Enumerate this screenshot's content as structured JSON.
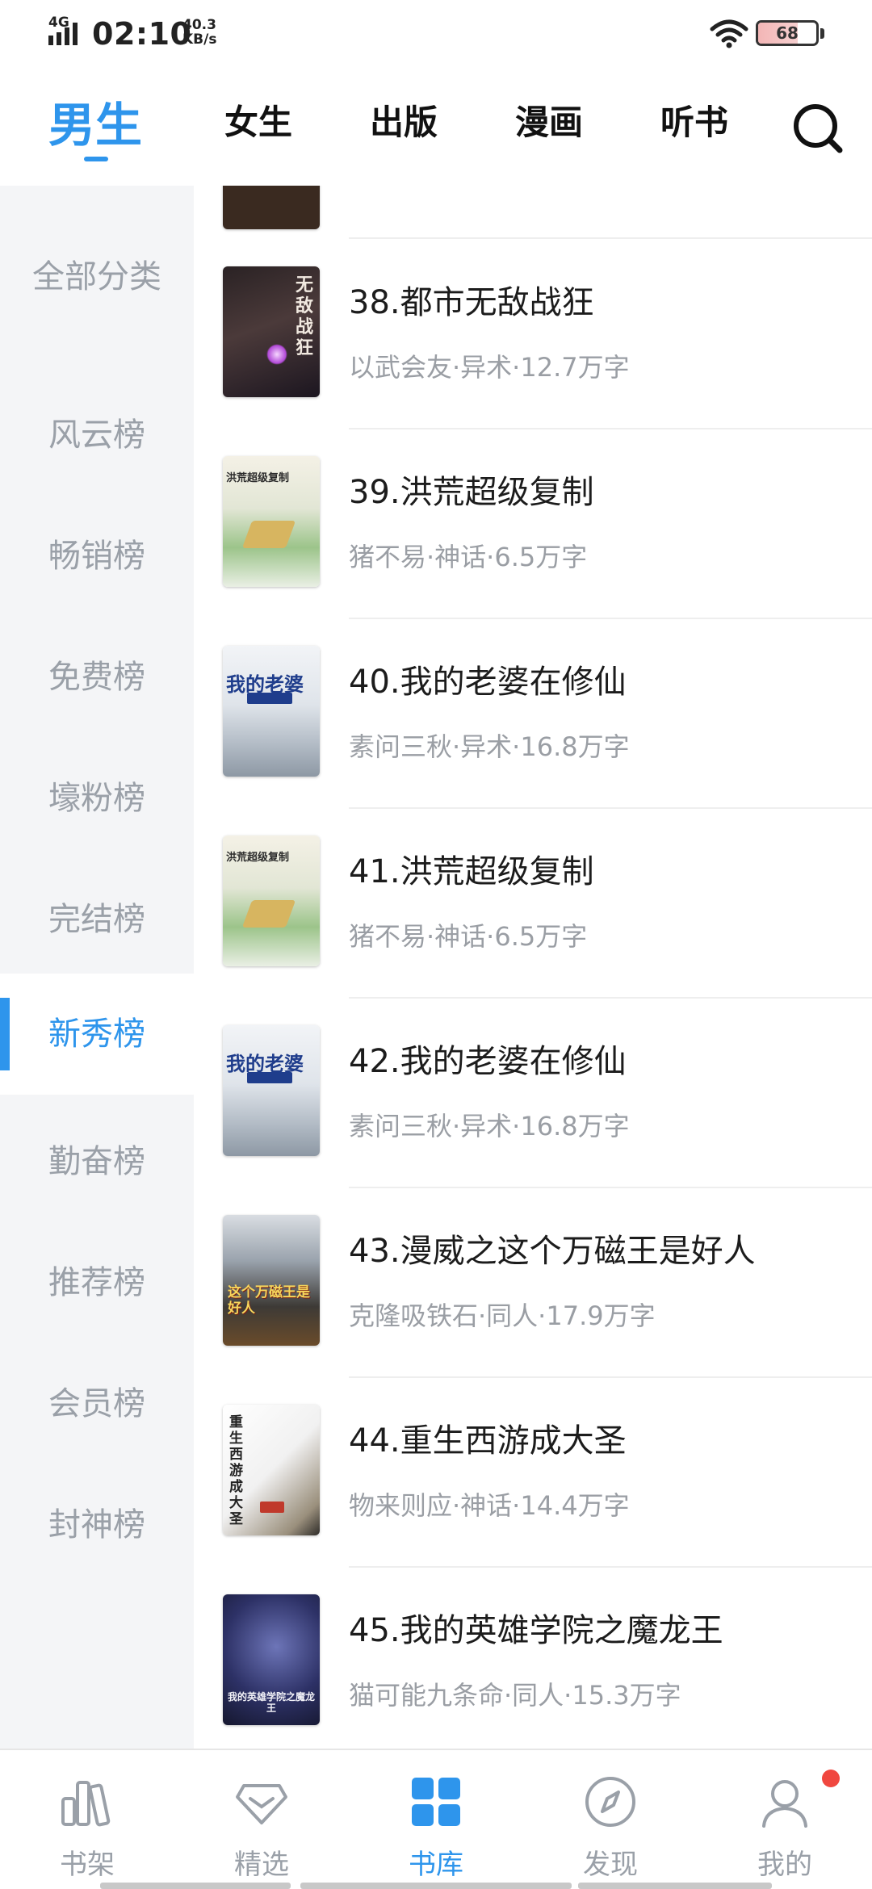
{
  "status_bar": {
    "network": "4G",
    "time": "02:10",
    "speed_value": "40.3",
    "speed_unit": "KB/s",
    "battery": "68",
    "battery_level": 0.68
  },
  "top_tabs": [
    {
      "label": "男生",
      "active": true
    },
    {
      "label": "女生",
      "active": false
    },
    {
      "label": "出版",
      "active": false
    },
    {
      "label": "漫画",
      "active": false
    },
    {
      "label": "听书",
      "active": false
    }
  ],
  "sidebar": {
    "items": [
      {
        "label": "全部分类"
      },
      {
        "label": "风云榜"
      },
      {
        "label": "畅销榜"
      },
      {
        "label": "免费榜"
      },
      {
        "label": "壕粉榜"
      },
      {
        "label": "完结榜"
      },
      {
        "label": "新秀榜"
      },
      {
        "label": "勤奋榜"
      },
      {
        "label": "推荐榜"
      },
      {
        "label": "会员榜"
      },
      {
        "label": "封神榜"
      }
    ],
    "active_item": "新秀榜"
  },
  "books": [
    {
      "title": "38.都市无敌战狂",
      "meta": "以武会友·异术·12.7万字",
      "cover_text": "无敌战狂"
    },
    {
      "title": "39.洪荒超级复制",
      "meta": "猪不易·神话·6.5万字",
      "cover_text": "洪荒超级复制"
    },
    {
      "title": "40.我的老婆在修仙",
      "meta": "素问三秋·异术·16.8万字",
      "cover_text": "我的老婆"
    },
    {
      "title": "41.洪荒超级复制",
      "meta": "猪不易·神话·6.5万字",
      "cover_text": "洪荒超级复制"
    },
    {
      "title": "42.我的老婆在修仙",
      "meta": "素问三秋·异术·16.8万字",
      "cover_text": "我的老婆"
    },
    {
      "title": "43.漫威之这个万磁王是好人",
      "meta": "克隆吸铁石·同人·17.9万字",
      "cover_text": "这个万磁王是好人"
    },
    {
      "title": "44.重生西游成大圣",
      "meta": "物来则应·神话·14.4万字",
      "cover_text": "重生西游成大圣"
    },
    {
      "title": "45.我的英雄学院之魔龙王",
      "meta": "猫可能九条命·同人·15.3万字",
      "cover_text": "我的英雄学院之魔龙王"
    }
  ],
  "bottom_nav": [
    {
      "label": "书架",
      "icon": "bookshelf-icon",
      "active": false
    },
    {
      "label": "精选",
      "icon": "diamond-icon",
      "active": false
    },
    {
      "label": "书库",
      "icon": "grid-icon",
      "active": true
    },
    {
      "label": "发现",
      "icon": "compass-icon",
      "active": false
    },
    {
      "label": "我的",
      "icon": "user-icon",
      "active": false
    }
  ],
  "colors": {
    "accent": "#2e95ec",
    "badge": "#f0473f",
    "sidebar_bg": "#f4f5f7",
    "muted_text": "#9aa0a8"
  }
}
